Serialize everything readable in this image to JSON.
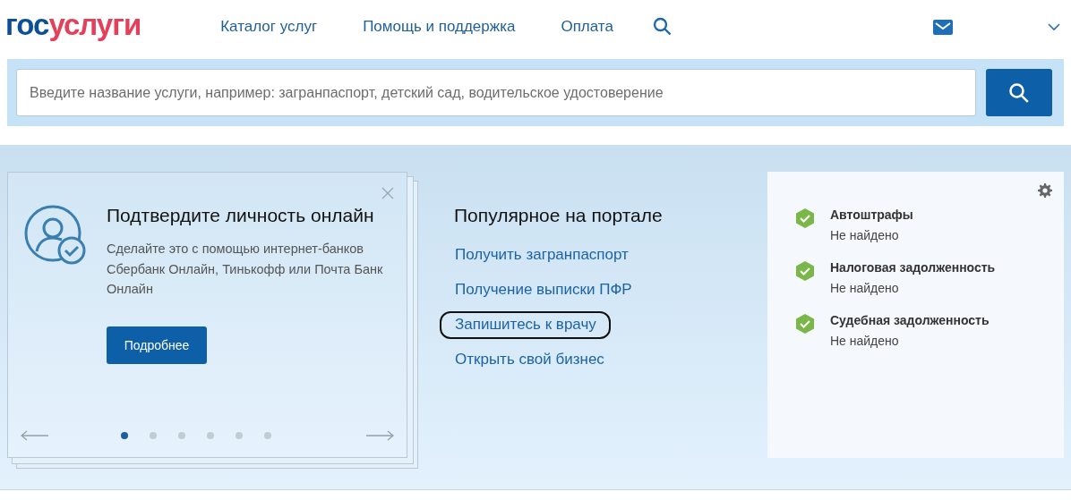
{
  "header": {
    "logo": {
      "part1": "гос",
      "part2": "услуги"
    },
    "nav": [
      {
        "label": "Каталог услуг"
      },
      {
        "label": "Помощь и поддержка"
      },
      {
        "label": "Оплата"
      }
    ]
  },
  "search": {
    "placeholder": "Введите название услуги, например: загранпаспорт, детский сад, водительское удостоверение"
  },
  "banner": {
    "title": "Подтвердите личность онлайн",
    "text": "Сделайте это с помощью интернет-банков Сбербанк Онлайн, Тинькофф или Почта Банк Онлайн",
    "button": "Подробнее",
    "dots": [
      {
        "selected": true
      },
      {
        "selected": false
      },
      {
        "selected": false
      },
      {
        "selected": false
      },
      {
        "selected": false
      },
      {
        "selected": false
      }
    ]
  },
  "popular": {
    "title": "Популярное на портале",
    "links": [
      {
        "label": "Получить загранпаспорт",
        "highlighted": false
      },
      {
        "label": "Получение выписки ПФР",
        "highlighted": false
      },
      {
        "label": "Запишитесь к врачу",
        "highlighted": true
      },
      {
        "label": "Открыть свой бизнес",
        "highlighted": false
      }
    ]
  },
  "checks": [
    {
      "title": "Автоштрафы",
      "status": "Не найдено",
      "ok": true
    },
    {
      "title": "Налоговая задолженность",
      "status": "Не найдено",
      "ok": true
    },
    {
      "title": "Судебная задолженность",
      "status": "Не найдено",
      "ok": true
    }
  ]
}
